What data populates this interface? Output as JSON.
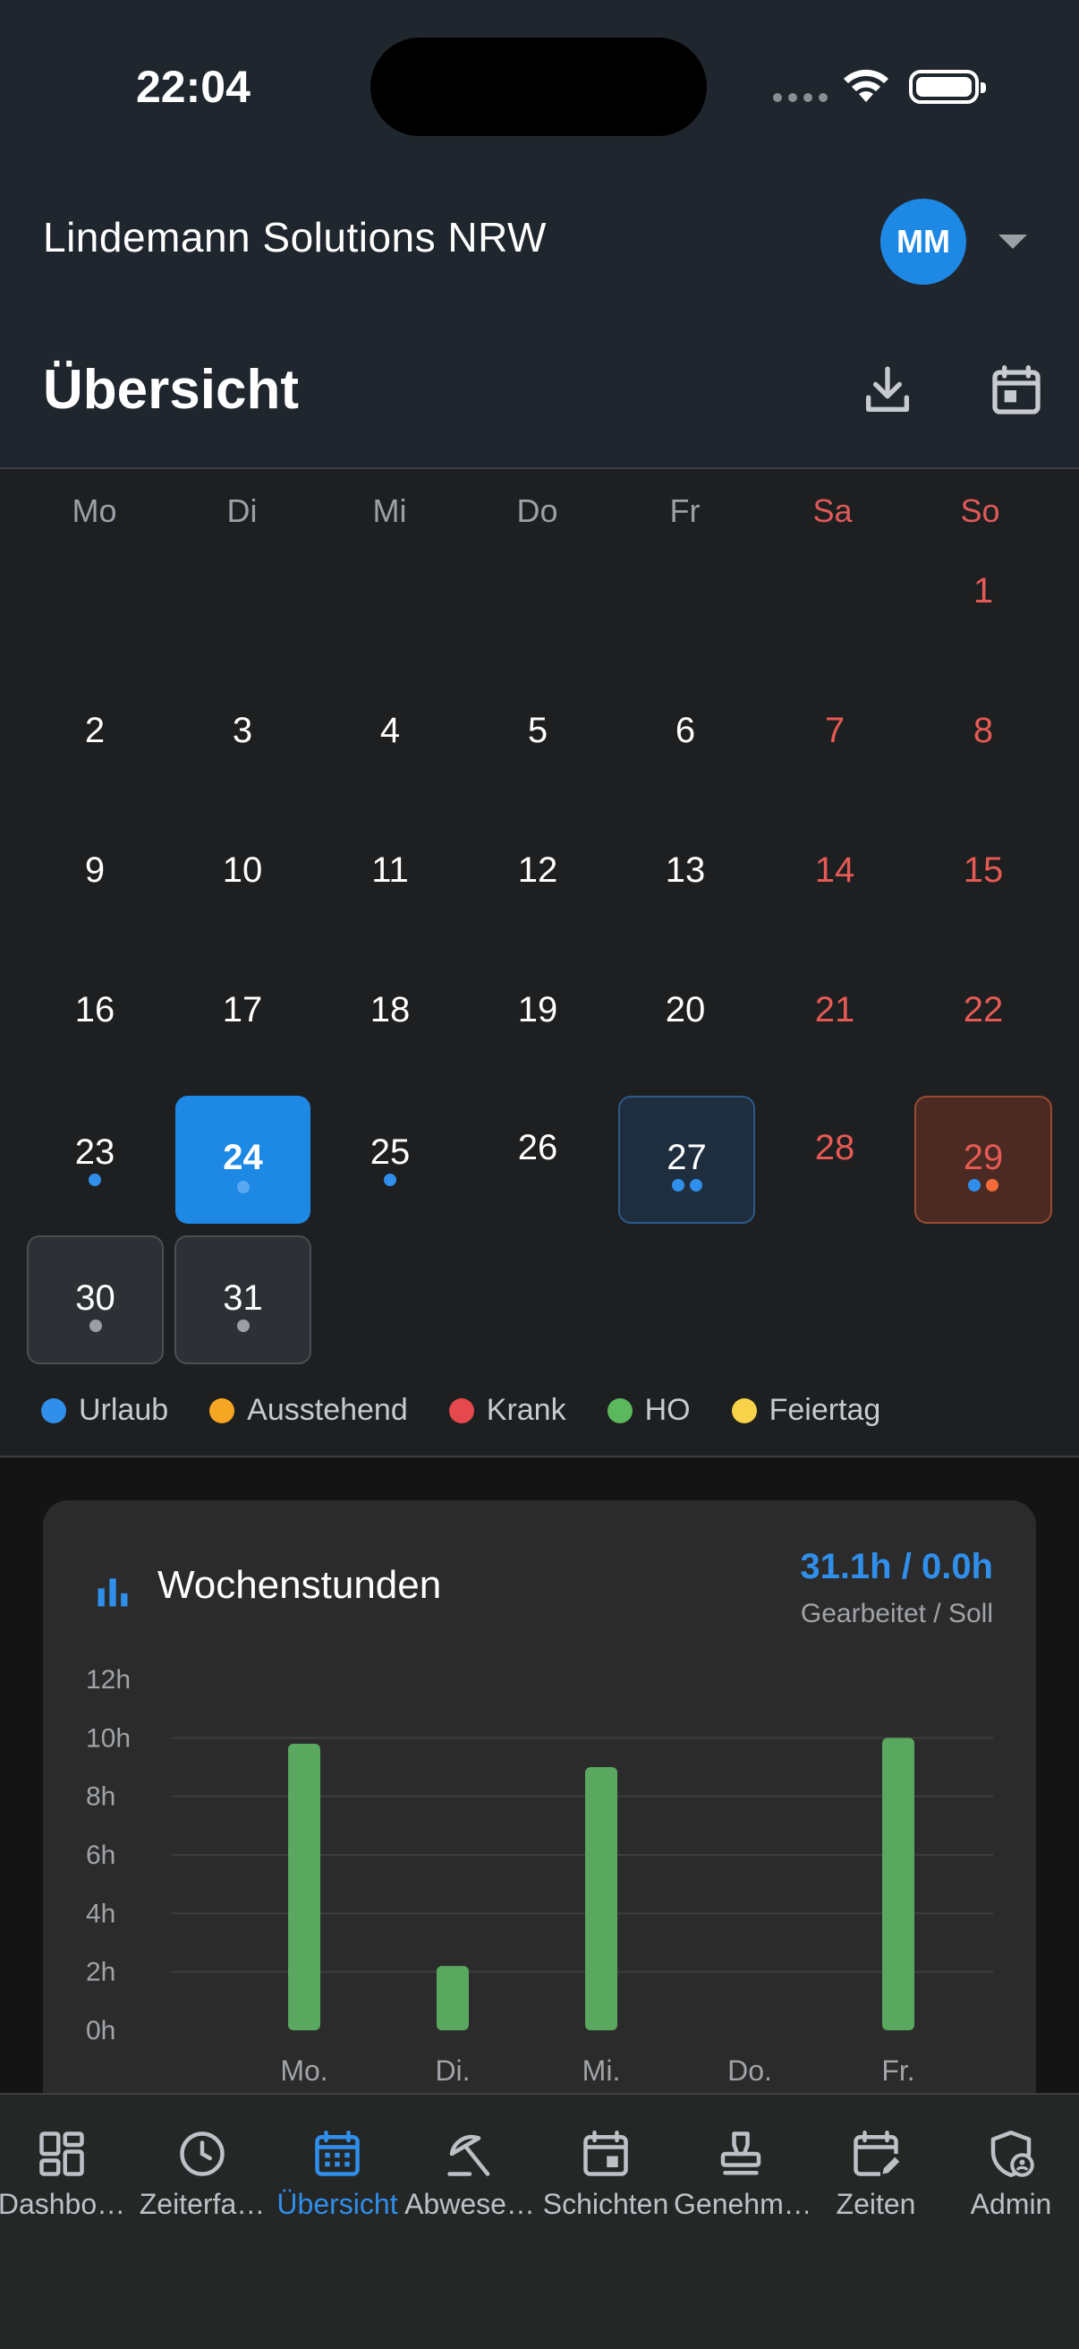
{
  "status": {
    "time": "22:04"
  },
  "header": {
    "company": "Lindemann Solutions NRW",
    "avatar_initials": "MM",
    "title": "Übersicht"
  },
  "calendar": {
    "weekdays": [
      "Mo",
      "Di",
      "Mi",
      "Do",
      "Fr",
      "Sa",
      "So"
    ],
    "weekend_color": "#e55a55",
    "days": [
      "1",
      "2",
      "3",
      "4",
      "5",
      "6",
      "7",
      "8",
      "9",
      "10",
      "11",
      "12",
      "13",
      "14",
      "15",
      "16",
      "17",
      "18",
      "19",
      "20",
      "21",
      "22",
      "23",
      "24",
      "25",
      "26",
      "27",
      "28",
      "29",
      "30",
      "31"
    ],
    "today": "24",
    "legend": [
      {
        "label": "Urlaub",
        "color": "#2f8fea"
      },
      {
        "label": "Ausstehend",
        "color": "#f5a623"
      },
      {
        "label": "Krank",
        "color": "#e5484d"
      },
      {
        "label": "HO",
        "color": "#5cb85c"
      },
      {
        "label": "Feiertag",
        "color": "#f8d34a"
      }
    ]
  },
  "weekly_card": {
    "title": "Wochenstunden",
    "total": "31.1h / 0.0h",
    "subtitle": "Gearbeitet / Soll"
  },
  "chart_data": {
    "type": "bar",
    "categories": [
      "Mo.",
      "Di.",
      "Mi.",
      "Do.",
      "Fr."
    ],
    "values": [
      9.8,
      2.2,
      9.0,
      0,
      10.0
    ],
    "ylim": [
      0,
      12
    ],
    "yticks": [
      "0h",
      "2h",
      "4h",
      "6h",
      "8h",
      "10h",
      "12h"
    ],
    "grid": true,
    "bar_color": "#5aa75f"
  },
  "nav": {
    "items": [
      {
        "label": "Dashbo…",
        "icon": "dashboard-icon"
      },
      {
        "label": "Zeiterfa…",
        "icon": "clock-icon"
      },
      {
        "label": "Übersicht",
        "icon": "calendar-icon"
      },
      {
        "label": "Abwese…",
        "icon": "beach-umbrella-icon"
      },
      {
        "label": "Schichten",
        "icon": "calendar-event-icon"
      },
      {
        "label": "Genehm…",
        "icon": "stamp-icon"
      },
      {
        "label": "Zeiten",
        "icon": "calendar-edit-icon"
      },
      {
        "label": "Admin",
        "icon": "admin-shield-icon"
      }
    ],
    "active": "Übersicht",
    "active_color": "#2f8fea"
  }
}
